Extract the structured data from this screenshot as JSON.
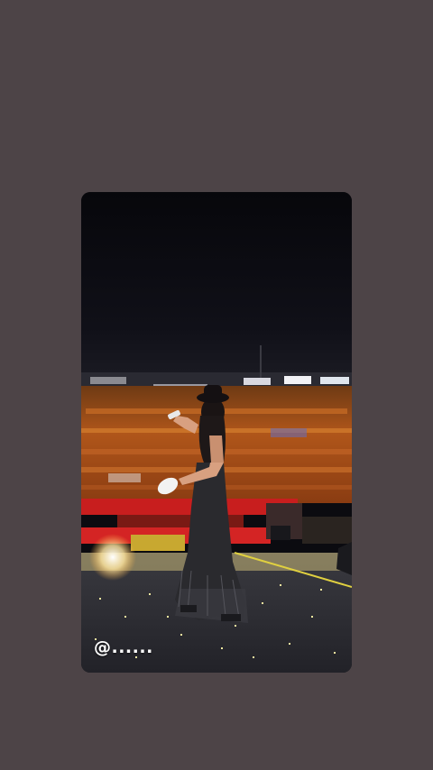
{
  "story": {
    "mention_text": "@......"
  },
  "colors": {
    "background": "#4d4447",
    "sky": "#0b0b10",
    "crowd": "#c0641e",
    "stage_rail": "#c81e1e",
    "stage_floor": "#2b2b30"
  }
}
